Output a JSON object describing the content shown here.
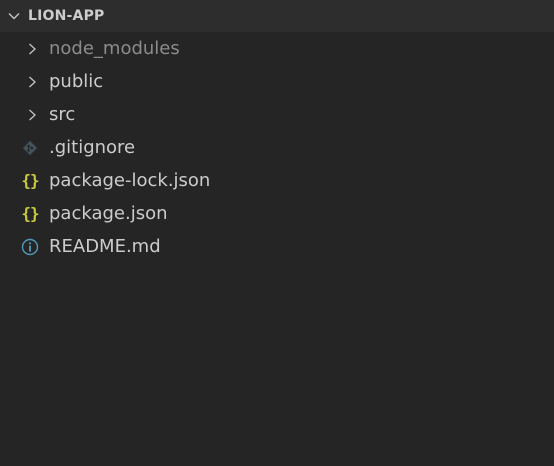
{
  "explorer": {
    "section": {
      "title": "LION-APP",
      "expanded": true
    },
    "items": [
      {
        "label": "node_modules",
        "type": "folder",
        "dimmed": true,
        "icon": "chevron-right-icon"
      },
      {
        "label": "public",
        "type": "folder",
        "dimmed": false,
        "icon": "chevron-right-icon"
      },
      {
        "label": "src",
        "type": "folder",
        "dimmed": false,
        "icon": "chevron-right-icon"
      },
      {
        "label": ".gitignore",
        "type": "file",
        "icon": "git-icon",
        "icon_color": "#41535b"
      },
      {
        "label": "package-lock.json",
        "type": "file",
        "icon": "json-icon",
        "icon_glyph": "{}",
        "icon_color": "#cbcb41"
      },
      {
        "label": "package.json",
        "type": "file",
        "icon": "json-icon",
        "icon_glyph": "{}",
        "icon_color": "#cbcb41"
      },
      {
        "label": "README.md",
        "type": "file",
        "icon": "info-icon",
        "icon_color": "#519aba"
      }
    ]
  },
  "colors": {
    "background": "#252526",
    "header_background": "#2d2d2e",
    "text": "#cccccc",
    "dimmed_text": "#8c8c8c"
  }
}
